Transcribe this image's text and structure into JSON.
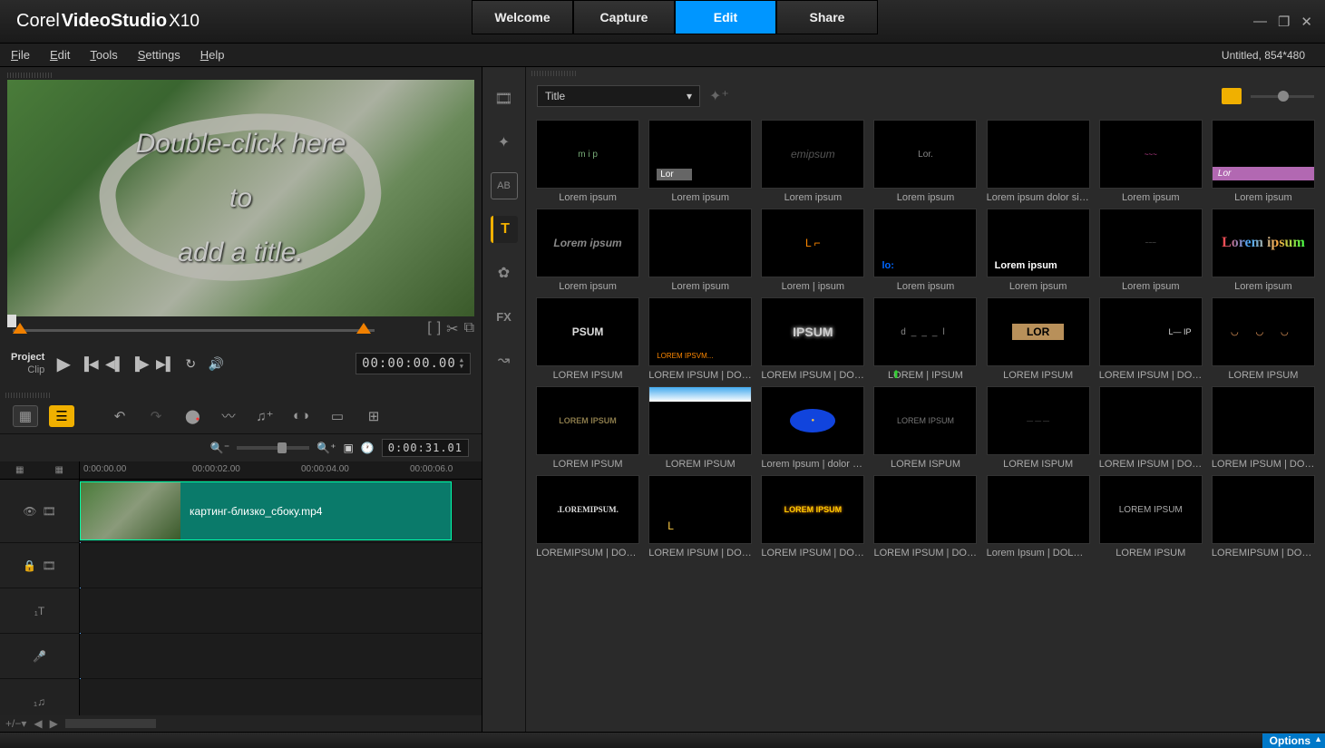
{
  "app": {
    "brand": "Corel",
    "name": "VideoStudio",
    "ver": "X10"
  },
  "steps": {
    "welcome": "Welcome",
    "capture": "Capture",
    "edit": "Edit",
    "share": "Share"
  },
  "win": {
    "min": "—",
    "max": "❐",
    "close": "✕"
  },
  "menu": {
    "file": "File",
    "edit": "Edit",
    "tools": "Tools",
    "settings": "Settings",
    "help": "Help"
  },
  "project_info": "Untitled, 854*480",
  "preview": {
    "line1": "Double-click here",
    "line2": "to",
    "line3": "add a title."
  },
  "mode": {
    "project": "Project",
    "clip": "Clip"
  },
  "timecode": "00:00:00.00",
  "timeline": {
    "duration": "0:00:31.01",
    "ruler": [
      "0:00:00.00",
      "00:00:02.00",
      "00:00:04.00",
      "00:00:06.0"
    ],
    "clip_name": "картинг-близко_сбоку.mp4"
  },
  "library": {
    "dropdown": "Title",
    "items": [
      {
        "label": "Lorem ipsum",
        "preview_text": "m  i  p",
        "style": "color:#7a7"
      },
      {
        "label": "Lorem ipsum",
        "preview_text": "Lor",
        "style": "background:#666;color:#fff;padding:1px 20px 1px 4px;font-size:10px;position:absolute;bottom:8px;left:8px"
      },
      {
        "label": "Lorem ipsum",
        "preview_text": "emipsum",
        "style": "color:#555;font-style:italic;font-size:12px"
      },
      {
        "label": "Lorem ipsum",
        "preview_text": "Lor.",
        "style": "color:#888;font-size:10px"
      },
      {
        "label": "Lorem ipsum dolor sit a...",
        "preview_text": "",
        "style": ""
      },
      {
        "label": "Lorem ipsum",
        "preview_text": "~~~",
        "style": "color:#c49;font-size:8px"
      },
      {
        "label": "Lorem ipsum",
        "preview_text": "Lor",
        "style": "background:#b268b2;color:#fff;padding:2px 30px 2px 6px;position:absolute;bottom:8px;left:0;right:0;font-style:italic;font-size:10px"
      },
      {
        "label": "Lorem ipsum",
        "preview_text": "Lorem ipsum",
        "style": "color:#888;font-style:italic;font-weight:bold;font-size:12px"
      },
      {
        "label": "Lorem ipsum",
        "preview_text": "",
        "style": ""
      },
      {
        "label": "Lorem | ipsum",
        "preview_text": "L  ⌐",
        "style": "color:#f80;font-size:12px"
      },
      {
        "label": "Lorem ipsum",
        "preview_text": "lo:",
        "style": "color:#06f;font-weight:bold;font-size:11px;position:absolute;bottom:6px;left:8px"
      },
      {
        "label": "Lorem ipsum",
        "preview_text": "Lorem ipsum",
        "style": "color:#fff;font-weight:bold;font-size:11px;position:absolute;bottom:6px;left:8px",
        "extra": "<span style='color:#f80'> ipsum</span>"
      },
      {
        "label": "Lorem ipsum",
        "preview_text": "~~~",
        "style": "color:#666;font-size:7px"
      },
      {
        "label": "Lorem ipsum",
        "preview_text": "Lorem ipsum",
        "style": "font-size:16px;font-weight:bold;font-family:serif;background:linear-gradient(90deg,#f44,#4af,#fa4,#4f4);-webkit-background-clip:text;color:transparent;line-height:1"
      },
      {
        "label": "LOREM IPSUM",
        "preview_text": "PSUM",
        "style": "color:#ddd;font-weight:bold;font-size:12px"
      },
      {
        "label": "LOREM IPSUM | DOL...",
        "preview_text": "LOREM IPSVM...",
        "style": "color:#f80;font-size:8px;position:absolute;bottom:6px;left:8px"
      },
      {
        "label": "LOREM IPSUM | DOL...",
        "preview_text": "IPSUM",
        "style": "color:#ccc;font-weight:bold;font-size:14px;text-shadow:0 0 4px #fff"
      },
      {
        "label": "LOREM | IPSUM",
        "preview_text": "d___l",
        "style": "color:#888;font-size:10px;letter-spacing:6px"
      },
      {
        "label": "LOREM IPSUM",
        "preview_text": "LOR",
        "style": "background:#b8905a;color:#000;padding:2px 16px;font-weight:bold;font-size:12px"
      },
      {
        "label": "LOREM IPSUM | DOL...",
        "preview_text": "L— IP",
        "style": "color:#ddd;font-size:9px;text-align:right;width:80%"
      },
      {
        "label": "LOREM IPSUM",
        "preview_text": "◡ ◡ ◡",
        "style": "color:#fa6;font-size:10px;letter-spacing:8px"
      },
      {
        "label": "LOREM IPSUM",
        "preview_text": "LOREM IPSUM",
        "style": "color:#8a7a4a;font-size:9px;font-weight:bold"
      },
      {
        "label": "LOREM IPSUM",
        "preview_text": "",
        "style": "background:linear-gradient(#4ae,#fff);position:absolute;top:0;left:0;right:0;height:16px"
      },
      {
        "label": "Lorem Ipsum |  dolor sit ...",
        "preview_text": "●",
        "style": "background:#14d;width:50px;height:26px;border-radius:50%;display:flex;align-items:center;justify-content:center;color:#fc4;font-size:6px"
      },
      {
        "label": "LOREM ISPUM",
        "preview_text": "LOREM IPSUM",
        "style": "color:#777;font-size:9px"
      },
      {
        "label": "LOREM ISPUM",
        "preview_text": "— — —",
        "style": "color:#555;font-size:7px"
      },
      {
        "label": "LOREM IPSUM | DOL...",
        "preview_text": "",
        "style": ""
      },
      {
        "label": "LOREM IPSUM | DOL...",
        "preview_text": "",
        "style": ""
      },
      {
        "label": "LOREMIPSUM | DOLO...",
        "preview_text": ".LOREMIPSUM.",
        "style": "color:#ddd;font-size:9px;font-weight:bold;font-family:serif"
      },
      {
        "label": "LOREM IPSUM | DOL...",
        "preview_text": "L",
        "style": "color:#fc4;font-size:12px;position:absolute;bottom:12px;left:20px"
      },
      {
        "label": "LOREM IPSUM | DOL...",
        "preview_text": "LOREM IPSUM",
        "style": "color:#fc0;font-size:9px;font-weight:bold;text-shadow:0 0 3px #f80"
      },
      {
        "label": "LOREM IPSUM | DOL...",
        "preview_text": "",
        "style": ""
      },
      {
        "label": "Lorem Ipsum | DOLOR ...",
        "preview_text": "",
        "style": ""
      },
      {
        "label": "LOREM IPSUM",
        "preview_text": "LOREM IPSUM",
        "style": "color:#aaa;font-size:10px"
      },
      {
        "label": "LOREMIPSUM | DOLO...",
        "preview_text": "",
        "style": ""
      }
    ]
  },
  "options": "Options"
}
